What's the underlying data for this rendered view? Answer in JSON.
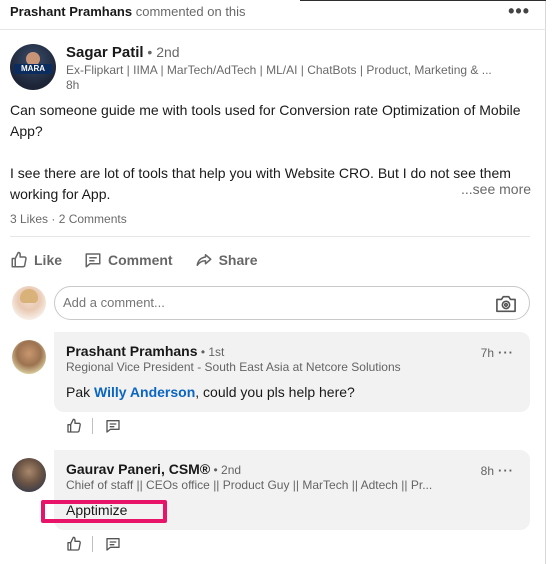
{
  "header": {
    "actor_name": "Prashant Pramhans",
    "action_text": " commented on this",
    "menu_icon": "more-horizontal-icon",
    "menu_glyph": "•••"
  },
  "post": {
    "author_name": "Sagar Patil",
    "author_degree": " • 2nd",
    "author_headline": "Ex-Flipkart | IIMA | MarTech/AdTech | ML/AI | ChatBots | Product, Marketing & ...",
    "time": "8h",
    "commentary_p1": "Can someone guide me with tools used for Conversion rate Optimization of Mobile App?",
    "commentary_p2": "I see there are lot of tools that help you with Website CRO. But I do not see them working for App.",
    "see_more": "...see more",
    "likes": "3 Likes",
    "separator": " · ",
    "comments_count": "2 Comments"
  },
  "actions": {
    "like_label": "Like",
    "comment_label": "Comment",
    "share_label": "Share"
  },
  "comment_box": {
    "placeholder": "Add a comment...",
    "icon": "camera-icon"
  },
  "comments": [
    {
      "name": "Prashant Pramhans",
      "degree": " • 1st",
      "headline": "Regional Vice President - South East Asia at Netcore Solutions",
      "time": "7h",
      "menu": "···",
      "text_prefix": "Pak ",
      "mention": "Willy Anderson",
      "text_suffix": ", could you pls help here?"
    },
    {
      "name": "Gaurav Paneri, CSM®",
      "degree": " • 2nd",
      "headline": "Chief of staff || CEOs office || Product Guy || MarTech || Adtech || Pr...",
      "time": "8h",
      "menu": "···",
      "text": "Apptimize"
    }
  ],
  "colors": {
    "mention": "#0a66c2",
    "highlight": "#e8146a",
    "bubble": "#f2f2f2"
  }
}
